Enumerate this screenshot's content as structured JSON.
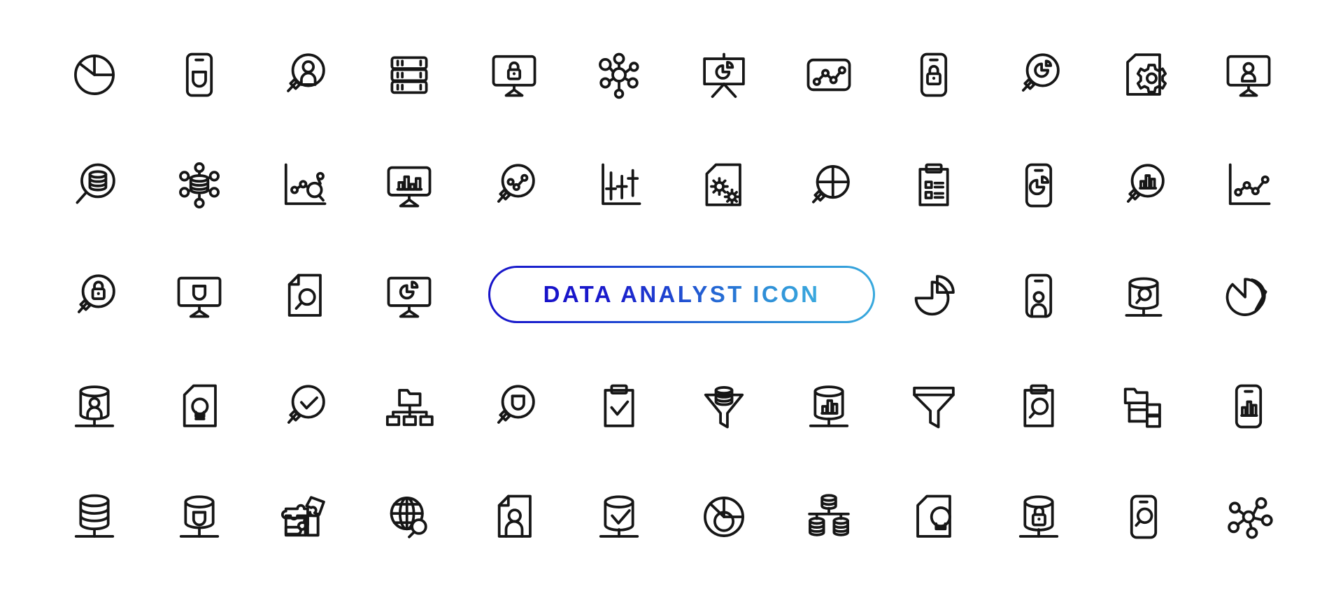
{
  "banner": {
    "label": "DATA ANALYST ICON",
    "gradient_start": "#1712c9",
    "gradient_end": "#38a9dd",
    "border_radius_px": 41
  },
  "sheet": {
    "background": "#ffffff",
    "stroke_color": "#161616",
    "columns": 12,
    "rows": 5,
    "total_icons": 56
  },
  "rows": [
    {
      "index": 1,
      "icons": [
        {
          "name": "pie-chart-icon",
          "label": "Pie Chart"
        },
        {
          "name": "mobile-database-icon",
          "label": "Mobile Database"
        },
        {
          "name": "magnifier-user-icon",
          "label": "User Search"
        },
        {
          "name": "server-rack-icon",
          "label": "Server Rack"
        },
        {
          "name": "monitor-lock-icon",
          "label": "Secure Monitor"
        },
        {
          "name": "network-nodes-icon",
          "label": "Network Nodes"
        },
        {
          "name": "presentation-pie-icon",
          "label": "Presentation Pie Chart"
        },
        {
          "name": "line-chart-box-icon",
          "label": "Line Chart Panel"
        },
        {
          "name": "mobile-lock-icon",
          "label": "Mobile Lock"
        },
        {
          "name": "magnifier-pie-icon",
          "label": "Pie Chart Search"
        },
        {
          "name": "document-gear-icon",
          "label": "Document Settings"
        },
        {
          "name": "monitor-user-icon",
          "label": "Monitor User"
        }
      ]
    },
    {
      "index": 2,
      "icons": [
        {
          "name": "magnifier-database-icon",
          "label": "Database Search"
        },
        {
          "name": "database-network-icon",
          "label": "Database Network"
        },
        {
          "name": "scatter-graph-icon",
          "label": "Scatter Graph"
        },
        {
          "name": "monitor-bar-chart-icon",
          "label": "Monitor Bar Chart"
        },
        {
          "name": "magnifier-line-chart-icon",
          "label": "Trend Search"
        },
        {
          "name": "box-plot-icon",
          "label": "Box Plot"
        },
        {
          "name": "document-gears-icon",
          "label": "Document Gears"
        },
        {
          "name": "magnifier-crosshair-icon",
          "label": "Target Search"
        },
        {
          "name": "clipboard-list-icon",
          "label": "Clipboard Checklist"
        },
        {
          "name": "mobile-pie-chart-icon",
          "label": "Mobile Pie Chart"
        },
        {
          "name": "magnifier-bar-chart-icon",
          "label": "Bar Chart Search"
        },
        {
          "name": "line-graph-axes-icon",
          "label": "Line Graph"
        }
      ]
    },
    {
      "index": 3,
      "icons": [
        {
          "name": "magnifier-lock-icon",
          "label": "Secure Search"
        },
        {
          "name": "monitor-database-icon",
          "label": "Monitor Database"
        },
        {
          "name": "document-magnifier-icon",
          "label": "Document Search"
        },
        {
          "name": "monitor-pie-chart-icon",
          "label": "Monitor Pie Chart"
        },
        {
          "name": "banner-placeholder",
          "label": ""
        },
        {
          "name": "banner-placeholder",
          "label": ""
        },
        {
          "name": "banner-placeholder",
          "label": ""
        },
        {
          "name": "banner-placeholder",
          "label": ""
        },
        {
          "name": "pie-chart-exploded-icon",
          "label": "Exploded Pie Chart"
        },
        {
          "name": "mobile-user-icon",
          "label": "Mobile User"
        },
        {
          "name": "database-magnifier-icon",
          "label": "Database Inspect"
        },
        {
          "name": "pie-chart-split-icon",
          "label": "Split Pie Chart"
        }
      ]
    },
    {
      "index": 4,
      "icons": [
        {
          "name": "database-user-icon",
          "label": "Database User"
        },
        {
          "name": "document-bulb-icon",
          "label": "Document Idea"
        },
        {
          "name": "magnifier-check-icon",
          "label": "Verified Search"
        },
        {
          "name": "folder-hierarchy-icon",
          "label": "Folder Hierarchy"
        },
        {
          "name": "magnifier-data-icon",
          "label": "Data Search"
        },
        {
          "name": "clipboard-check-icon",
          "label": "Clipboard Approved"
        },
        {
          "name": "funnel-database-icon",
          "label": "Data Funnel"
        },
        {
          "name": "database-bar-chart-icon",
          "label": "Database Analytics"
        },
        {
          "name": "funnel-filter-icon",
          "label": "Filter Funnel"
        },
        {
          "name": "clipboard-magnifier-icon",
          "label": "Clipboard Search"
        },
        {
          "name": "folder-tree-icon",
          "label": "Folder Tree"
        },
        {
          "name": "mobile-bar-chart-icon",
          "label": "Mobile Bar Chart"
        }
      ]
    },
    {
      "index": 5,
      "icons": [
        {
          "name": "database-stack-icon",
          "label": "Database Stack"
        },
        {
          "name": "database-server-icon",
          "label": "Database Server"
        },
        {
          "name": "puzzle-pieces-icon",
          "label": "Puzzle Integration"
        },
        {
          "name": "globe-search-icon",
          "label": "Global Search"
        },
        {
          "name": "document-user-icon",
          "label": "User Document"
        },
        {
          "name": "database-check-icon",
          "label": "Database Verified"
        },
        {
          "name": "donut-chart-icon",
          "label": "Donut Chart"
        },
        {
          "name": "database-tree-icon",
          "label": "Distributed Database"
        },
        {
          "name": "document-idea-icon",
          "label": "Idea Document"
        },
        {
          "name": "database-lock-icon",
          "label": "Database Security"
        },
        {
          "name": "mobile-search-icon",
          "label": "Mobile Search"
        },
        {
          "name": "molecule-nodes-icon",
          "label": "Data Cluster"
        }
      ]
    }
  ]
}
